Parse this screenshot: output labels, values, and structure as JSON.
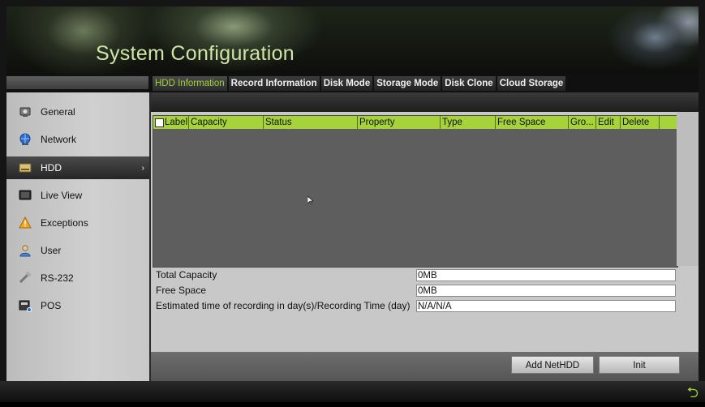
{
  "window": {
    "title": "System Configuration"
  },
  "tabs": [
    {
      "label": "HDD Information",
      "active": true
    },
    {
      "label": "Record Information"
    },
    {
      "label": "Disk Mode"
    },
    {
      "label": "Storage Mode"
    },
    {
      "label": "Disk Clone"
    },
    {
      "label": "Cloud Storage"
    }
  ],
  "sidebar": {
    "items": [
      {
        "label": "General",
        "icon": "general-icon"
      },
      {
        "label": "Network",
        "icon": "network-icon"
      },
      {
        "label": "HDD",
        "icon": "hdd-icon",
        "active": true
      },
      {
        "label": "Live View",
        "icon": "live-view-icon"
      },
      {
        "label": "Exceptions",
        "icon": "warning-icon"
      },
      {
        "label": "User",
        "icon": "user-icon"
      },
      {
        "label": "RS-232",
        "icon": "rs232-icon"
      },
      {
        "label": "POS",
        "icon": "pos-icon"
      }
    ]
  },
  "table": {
    "columns": [
      "Label",
      "Capacity",
      "Status",
      "Property",
      "Type",
      "Free Space",
      "Gro...",
      "Edit",
      "Delete"
    ],
    "rows": []
  },
  "info": {
    "total_capacity_label": "Total Capacity",
    "total_capacity_value": "0MB",
    "free_space_label": "Free Space",
    "free_space_value": "0MB",
    "estimated_label": "Estimated time of recording in day(s)/Recording Time (day)",
    "estimated_value": "N/A/N/A"
  },
  "buttons": {
    "add_nethdd": "Add NetHDD",
    "init": "Init"
  },
  "colors": {
    "accent": "#9fd23c",
    "header_row": "#a6d33a",
    "title": "#cfe6a4"
  }
}
